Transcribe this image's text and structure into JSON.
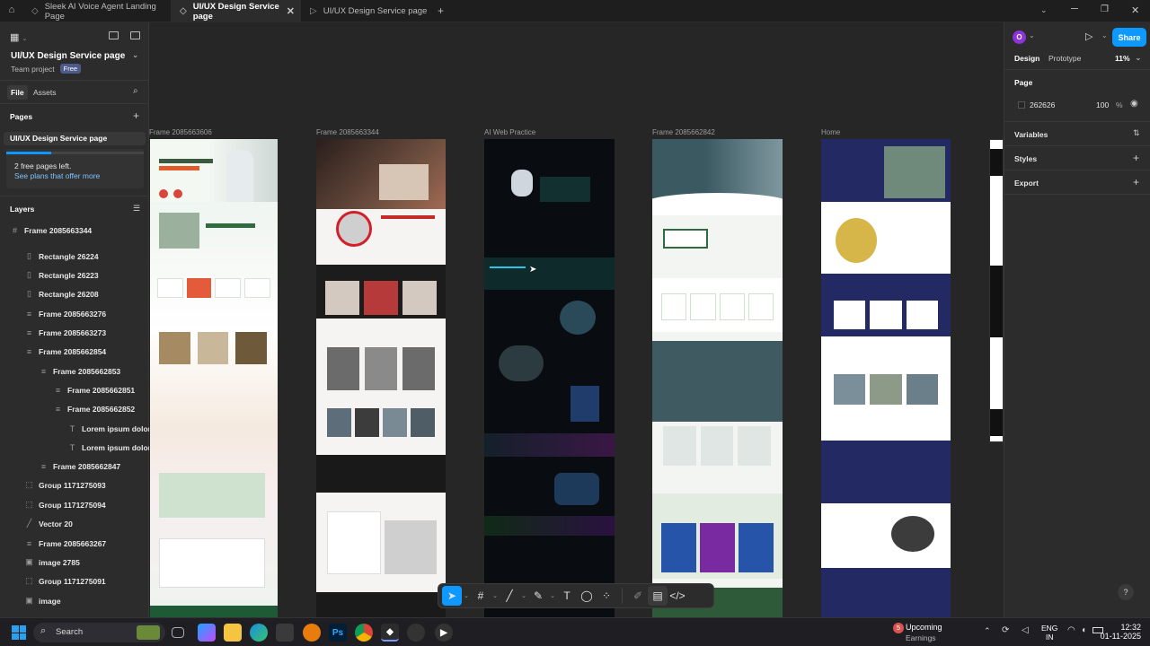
{
  "tabs": [
    {
      "label": "Sleek AI Voice Agent Landing Page"
    },
    {
      "label": "UI/UX Design Service page"
    },
    {
      "label": "UI/UX Design Service page"
    }
  ],
  "left_panel": {
    "file_title": "UI/UX Design Service page",
    "team": "Team project",
    "plan_badge": "Free",
    "tabs": {
      "file": "File",
      "assets": "Assets"
    },
    "pages_heading": "Pages",
    "current_page": "UI/UX Design Service page",
    "free_pages_text": "2 free pages left.",
    "see_plans_link": "See plans that offer more",
    "layers_heading": "Layers",
    "layers": [
      "Frame 2085663344",
      "Rectangle 26224",
      "Rectangle 26223",
      "Rectangle 26208",
      "Frame 2085663276",
      "Frame 2085663273",
      "Frame 2085662854",
      "Frame 2085662853",
      "Frame 2085662851",
      "Frame 2085662852",
      "Lorem ipsum dolor sit",
      "Lorem ipsum dolor sit",
      "Frame 2085662847",
      "Group 1171275093",
      "Group 1171275094",
      "Vector 20",
      "Frame 2085663267",
      "image 2785",
      "Group 1171275091",
      "image"
    ]
  },
  "canvas": {
    "frame_labels": [
      "Frame 2085663606",
      "Frame 2085663344",
      "AI Web Practice",
      "Frame 2085662842",
      "Home"
    ]
  },
  "right_panel": {
    "avatar_letter": "O",
    "share_label": "Share",
    "design_tab": "Design",
    "prototype_tab": "Prototype",
    "zoom": "11%",
    "page_heading": "Page",
    "bg_hex": "262626",
    "bg_opacity": "100",
    "percent": "%",
    "variables": "Variables",
    "styles": "Styles",
    "export": "Export"
  },
  "taskbar": {
    "search": "Search",
    "notif_count": "5",
    "stock_title": "Upcoming",
    "stock_sub": "Earnings",
    "lang": "ENG",
    "region": "IN",
    "time": "12:32",
    "date": "01-11-2025"
  },
  "colors": {
    "accent": "#0d99ff",
    "canvas": "#262626",
    "panel": "#2c2c2c"
  }
}
